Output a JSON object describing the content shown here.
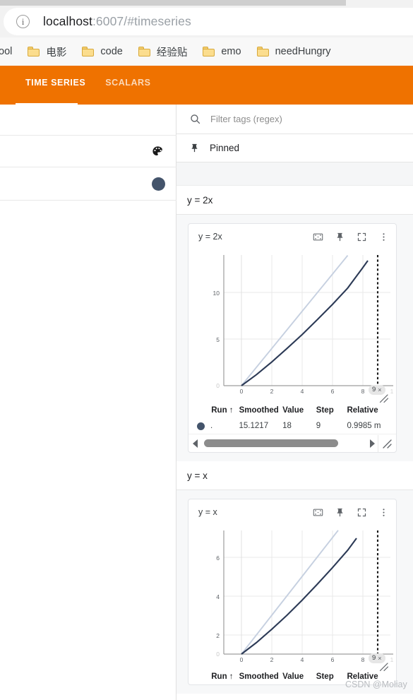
{
  "browser": {
    "info_icon": "info-icon",
    "url_host": "localhost",
    "url_rest": ":6007/#timeseries",
    "bookmarks": [
      {
        "label": "tool",
        "has_folder_icon": false
      },
      {
        "label": "电影",
        "has_folder_icon": true
      },
      {
        "label": "code",
        "has_folder_icon": true
      },
      {
        "label": "经验贴",
        "has_folder_icon": true
      },
      {
        "label": "emo",
        "has_folder_icon": true
      },
      {
        "label": "needHungry",
        "has_folder_icon": true
      }
    ]
  },
  "header": {
    "accent_color": "#ef7200",
    "tabs": [
      {
        "label": "TIME SERIES",
        "active": true
      },
      {
        "label": "SCALARS",
        "active": false
      }
    ]
  },
  "left_panel": {
    "palette_icon": "palette-icon",
    "run_color_dot": "#44546b"
  },
  "dashboard": {
    "search_icon": "search-icon",
    "filter_placeholder": "Filter tags (regex)",
    "filter_value": "",
    "pinned_icon": "pin-icon",
    "pinned_label": "Pinned",
    "groups": [
      {
        "name": "y = 2x",
        "card": {
          "title": "y = 2x",
          "actions": [
            "fit-to-domain-icon",
            "pin-icon",
            "fullscreen-icon",
            "overflow-menu-icon"
          ],
          "axis_badge": {
            "value": "9",
            "close_glyph": "×"
          },
          "table": {
            "columns": [
              "Run ↑",
              "Smoothed",
              "Value",
              "Step",
              "Relative"
            ],
            "rows": [
              {
                "run": ".",
                "smoothed": "15.1217",
                "value": "18",
                "step": "9",
                "relative": "0.9985 m"
              }
            ]
          },
          "scrollbar": {
            "left_arrow": "◀",
            "right_arrow": "▶",
            "resize_icon": "resize-grip-icon"
          }
        }
      },
      {
        "name": "y = x",
        "card": {
          "title": "y = x",
          "actions": [
            "fit-to-domain-icon",
            "pin-icon",
            "fullscreen-icon",
            "overflow-menu-icon"
          ],
          "axis_badge": {
            "value": "9",
            "close_glyph": "×"
          },
          "table": {
            "columns": [
              "Run ↑",
              "Smoothed",
              "Value",
              "Step",
              "Relative"
            ],
            "rows": []
          }
        }
      }
    ]
  },
  "watermark": "CSDN @Moliay",
  "chart_data": [
    {
      "type": "line",
      "title": "y = 2x",
      "xlabel": "",
      "ylabel": "",
      "xlim": [
        -0.55,
        9.6
      ],
      "ylim": [
        -0.6,
        18.4
      ],
      "xticks": [
        0,
        2,
        4,
        6,
        8
      ],
      "yticks": [
        5,
        10
      ],
      "grid": true,
      "legend_position": "none",
      "annotations": [
        {
          "type": "vline",
          "x": 9,
          "style": "dotted",
          "label": "9"
        }
      ],
      "series": [
        {
          "name": "raw",
          "color": "#c6d0e0",
          "x": [
            0,
            1,
            2,
            3,
            4,
            5,
            6,
            7,
            8,
            9
          ],
          "values": [
            0,
            2,
            4,
            6,
            8,
            10,
            12,
            14,
            16,
            18
          ]
        },
        {
          "name": "smoothed",
          "color": "#2c3a56",
          "x": [
            0,
            1,
            2,
            3,
            4,
            5,
            6,
            7,
            8,
            9
          ],
          "values": [
            0,
            1.2,
            2.55,
            4.0,
            5.5,
            7.1,
            8.75,
            10.5,
            12.7,
            15.1217
          ]
        }
      ]
    },
    {
      "type": "line",
      "title": "y = x",
      "xlabel": "",
      "ylabel": "",
      "xlim": [
        -0.55,
        9.6
      ],
      "ylim": [
        -0.3,
        9.2
      ],
      "xticks": [
        0,
        2,
        4,
        6,
        8
      ],
      "yticks": [
        2,
        4,
        6
      ],
      "grid": true,
      "legend_position": "none",
      "annotations": [
        {
          "type": "vline",
          "x": 9,
          "style": "dotted",
          "label": "9"
        }
      ],
      "series": [
        {
          "name": "raw",
          "color": "#c6d0e0",
          "x": [
            0,
            1,
            2,
            3,
            4,
            5,
            6,
            7,
            8,
            9
          ],
          "values": [
            0,
            1,
            2,
            3,
            4,
            5,
            6,
            7,
            8,
            9
          ]
        },
        {
          "name": "smoothed",
          "color": "#2c3a56",
          "x": [
            0,
            1,
            2,
            3,
            4,
            5,
            6,
            7,
            8,
            9
          ],
          "values": [
            0,
            0.6,
            1.28,
            2.0,
            2.78,
            3.6,
            4.45,
            5.35,
            6.4,
            7.56
          ]
        }
      ]
    }
  ]
}
